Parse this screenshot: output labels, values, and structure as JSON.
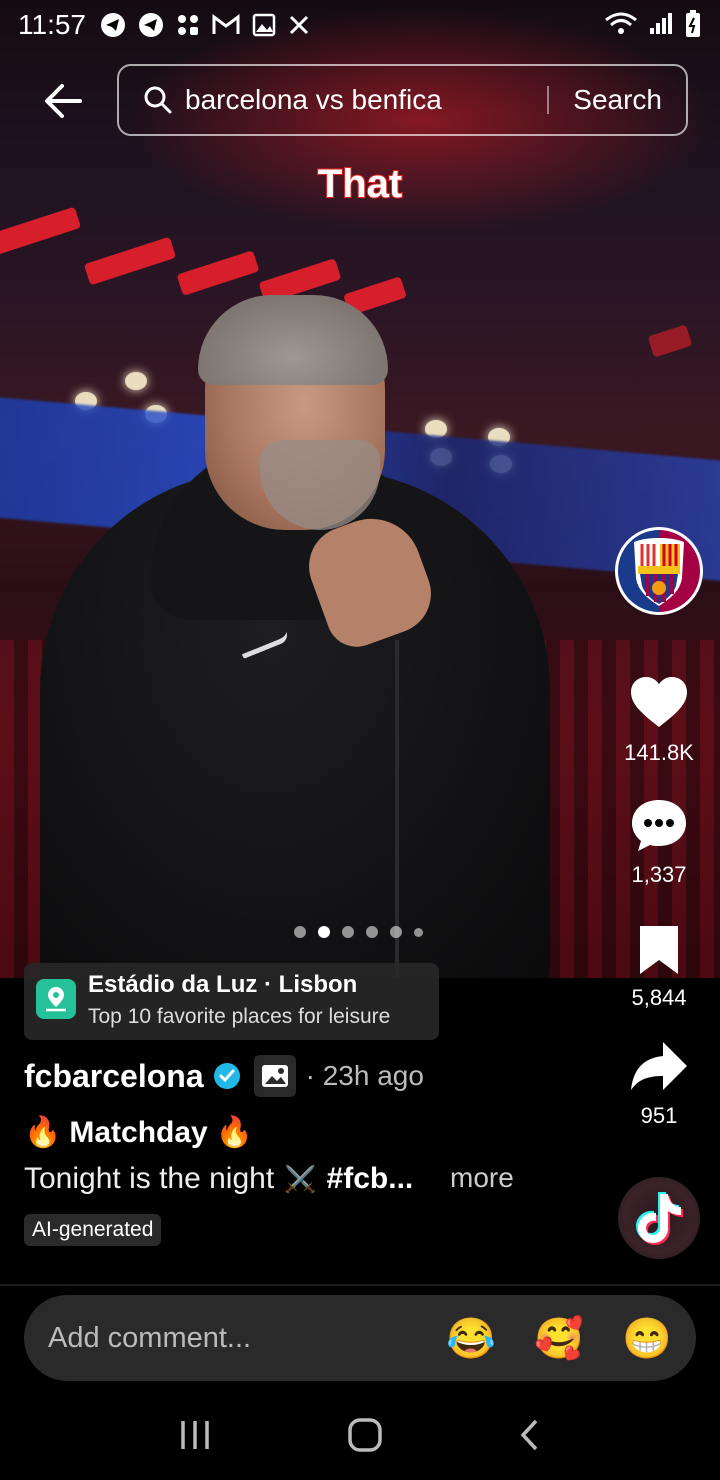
{
  "status_bar": {
    "time": "11:57",
    "icons": [
      "telegram-icon",
      "telegram-icon",
      "app-icon",
      "gmail-icon",
      "gallery-icon",
      "x-icon"
    ],
    "right_icons": [
      "wifi-icon",
      "signal-icon",
      "battery-icon"
    ]
  },
  "search": {
    "query": "barcelona vs benfica",
    "button": "Search"
  },
  "overlay": {
    "caption": "That"
  },
  "rail": {
    "likes": "141.8K",
    "comments": "1,337",
    "saves": "5,844",
    "shares": "951"
  },
  "carousel": {
    "count": 6,
    "active_index": 1
  },
  "location": {
    "title": "Estádio da Luz · Lisbon",
    "subtitle": "Top 10 favorite places for leisure"
  },
  "post": {
    "author": "fcbarcelona",
    "time_ago": "· 23h ago",
    "title_emoji": "🔥",
    "title": "Matchday",
    "description": "Tonight is the night",
    "description_emoji": "⚔️",
    "hashtag": "#fcb...",
    "more": "more",
    "badge": "AI-generated"
  },
  "comment": {
    "placeholder": "Add comment...",
    "emojis": [
      "😂",
      "🥰",
      "😁"
    ]
  },
  "colors": {
    "accent_red": "#e0202c",
    "verified_blue": "#20b8e8",
    "location_green": "#25c29a"
  }
}
